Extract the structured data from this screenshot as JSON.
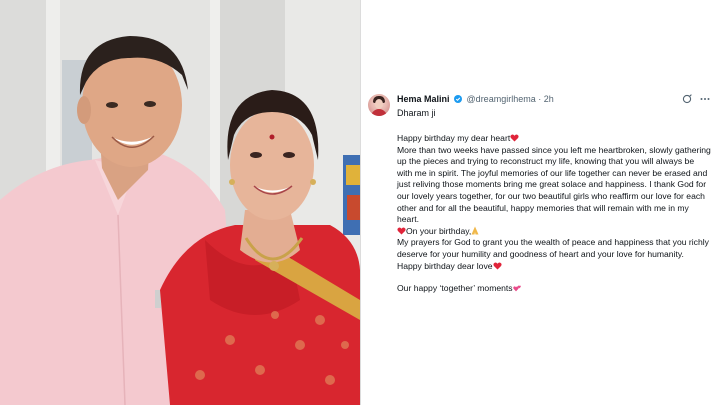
{
  "post": {
    "author_name": "Hema Malini",
    "handle": "@dreamgirlhema",
    "separator": "·",
    "time": "2h",
    "reply_to": "Dharam ji",
    "lines": {
      "l1": "Happy birthday my dear heart",
      "l2": "More than two weeks have passed since you left me heartbroken, slowly gathering up the pieces and trying to reconstruct my life, knowing that you will always be with me in spirit. The joyful memories of our life together can never be erased and just reliving those moments bring me great solace and happiness. I thank God for our lovely years together, for our two beautiful girls who reaffirm our love for each other and for all the beautiful, happy memories that will remain with me in my heart.",
      "l3": "On your birthday,",
      "l4": "My prayers for God to grant you the wealth of peace and happiness that you richly deserve for your humility and goodness of heart and your love for humanity.",
      "l5": "Happy birthday dear love",
      "l6": "Our happy ‘together’ moments"
    }
  },
  "icons": {
    "verified": "verified-badge-icon",
    "grok": "grok-icon",
    "more": "more-options-icon",
    "heart": "red-heart-emoji",
    "hands": "folded-hands-emoji",
    "hearts": "two-hearts-emoji"
  },
  "colors": {
    "text": "#0f1419",
    "secondary": "#536471",
    "verified": "#1d9bf0",
    "heart": "#e0243a"
  }
}
